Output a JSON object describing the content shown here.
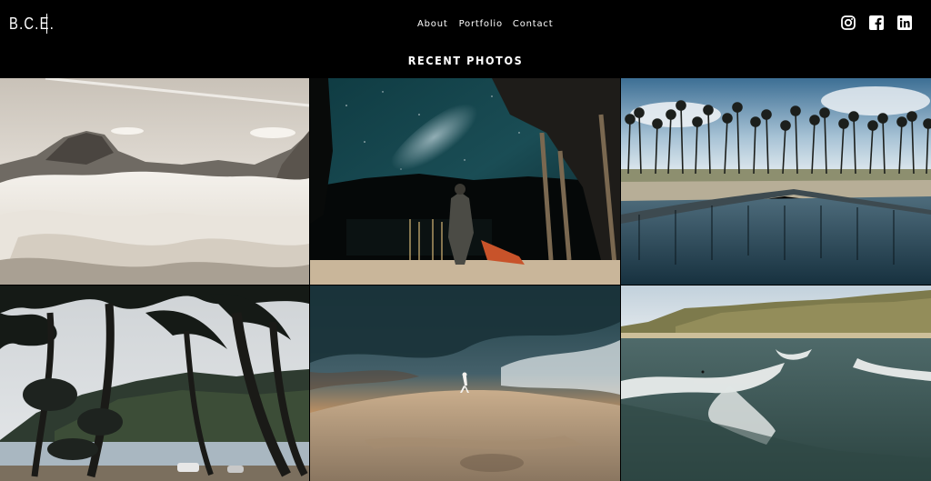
{
  "header": {
    "logo": "B.C.E.",
    "nav": [
      "About",
      "Portfolio",
      "Contact"
    ],
    "social": [
      {
        "icon": "instagram-icon"
      },
      {
        "icon": "facebook-icon"
      },
      {
        "icon": "linkedin-icon"
      }
    ]
  },
  "gallery": {
    "title": "RECENT PHOTOS",
    "photos": [
      {
        "name": "photo-mountain-clouds"
      },
      {
        "name": "photo-milky-way-kayak"
      },
      {
        "name": "photo-palm-lagoon"
      },
      {
        "name": "photo-palm-trees-coast"
      },
      {
        "name": "photo-dune-sunset"
      },
      {
        "name": "photo-coastal-waves"
      }
    ]
  }
}
